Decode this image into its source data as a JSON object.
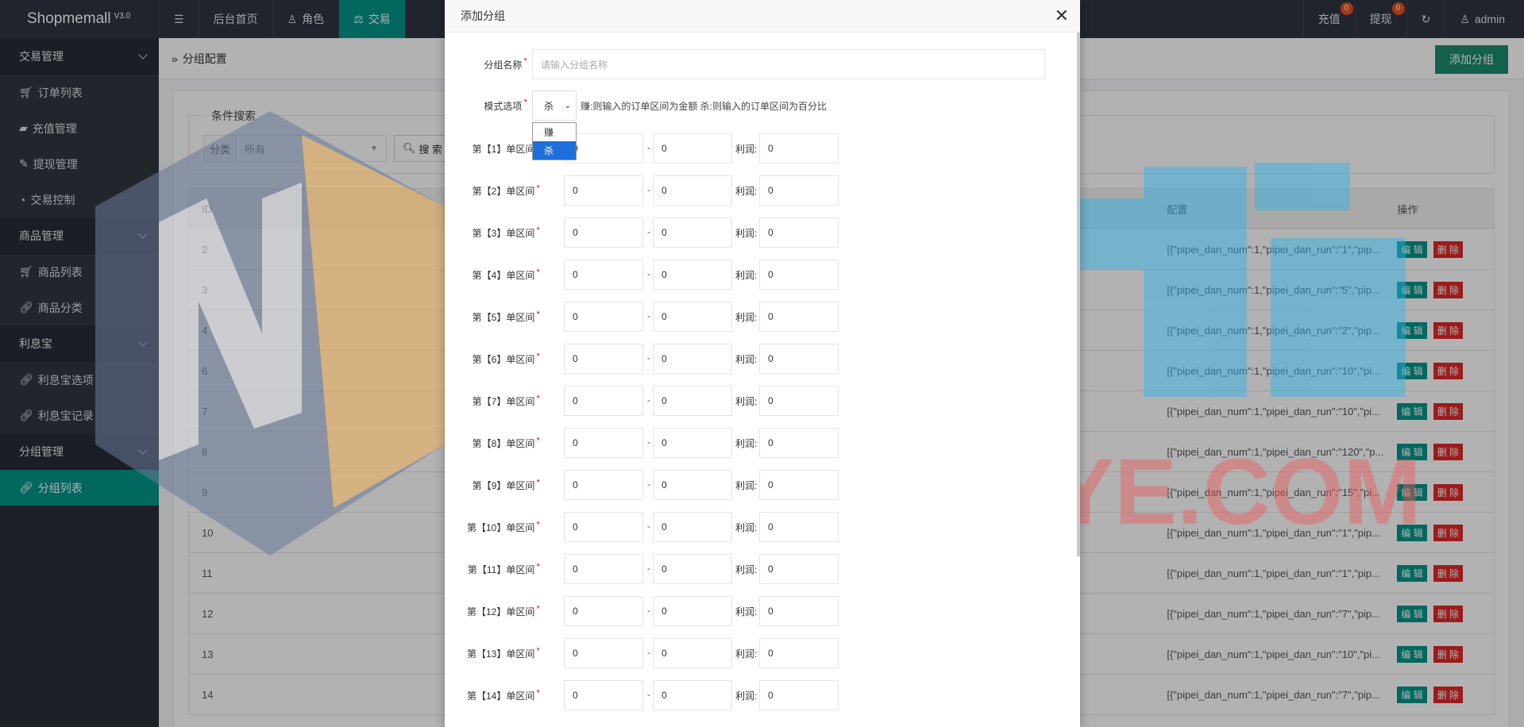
{
  "app": {
    "name": "Shopmemall",
    "version": "V3.0"
  },
  "topnav": {
    "items": [
      {
        "label": "后台首页",
        "icon": "home-icon"
      },
      {
        "label": "角色",
        "icon": "user-icon"
      },
      {
        "label": "交易",
        "icon": "scale-icon",
        "active": true
      }
    ],
    "right": [
      {
        "label": "充值",
        "badge": "0"
      },
      {
        "label": "提现",
        "badge": "0"
      },
      {
        "label": "",
        "icon": "refresh-icon"
      },
      {
        "label": "admin",
        "icon": "user-icon"
      }
    ]
  },
  "sidebar": {
    "groups": [
      {
        "label": "交易管理",
        "items": [
          "订单列表",
          "充值管理",
          "提现管理",
          "交易控制"
        ]
      },
      {
        "label": "商品管理",
        "items": [
          "商品列表",
          "商品分类"
        ]
      },
      {
        "label": "利息宝",
        "items": [
          "利息宝选项",
          "利息宝记录"
        ]
      },
      {
        "label": "分组管理",
        "items": [
          "分组列表"
        ]
      }
    ]
  },
  "main": {
    "breadcrumb": "分组配置",
    "add_button": "添加分组",
    "search": {
      "legend": "条件搜索",
      "category_label": "分类",
      "category_value": "所有",
      "button": "搜 索"
    },
    "table": {
      "headers": {
        "id": "ID",
        "config": "配置",
        "ops": "操作"
      },
      "rows": [
        {
          "id": "2",
          "config": "[{\"pipei_dan_num\":1,\"pipei_dan_run\":\"1\",\"pip..."
        },
        {
          "id": "3",
          "config": "[{\"pipei_dan_num\":1,\"pipei_dan_run\":\"5\",\"pip..."
        },
        {
          "id": "4",
          "config": "[{\"pipei_dan_num\":1,\"pipei_dan_run\":\"2\",\"pip..."
        },
        {
          "id": "6",
          "config": "[{\"pipei_dan_num\":1,\"pipei_dan_run\":\"10\",\"pi..."
        },
        {
          "id": "7",
          "config": "[{\"pipei_dan_num\":1,\"pipei_dan_run\":\"10\",\"pi..."
        },
        {
          "id": "8",
          "config": "[{\"pipei_dan_num\":1,\"pipei_dan_run\":\"120\",\"p..."
        },
        {
          "id": "9",
          "config": "[{\"pipei_dan_num\":1,\"pipei_dan_run\":\"15\",\"pi..."
        },
        {
          "id": "10",
          "config": "[{\"pipei_dan_num\":1,\"pipei_dan_run\":\"1\",\"pip..."
        },
        {
          "id": "11",
          "config": "[{\"pipei_dan_num\":1,\"pipei_dan_run\":\"1\",\"pip..."
        },
        {
          "id": "12",
          "config": "[{\"pipei_dan_num\":1,\"pipei_dan_run\":\"7\",\"pip..."
        },
        {
          "id": "13",
          "config": "[{\"pipei_dan_num\":1,\"pipei_dan_run\":\"10\",\"pi..."
        },
        {
          "id": "14",
          "config": "[{\"pipei_dan_num\":1,\"pipei_dan_run\":\"7\",\"pip..."
        }
      ],
      "edit_label": "编 辑",
      "delete_label": "删 除"
    }
  },
  "modal": {
    "title": "添加分组",
    "name_label": "分组名称",
    "name_placeholder": "请输入分组名称",
    "mode_label": "模式选项",
    "mode_value": "杀",
    "mode_options": [
      "赚",
      "杀"
    ],
    "mode_help": "赚:则输入的订单区间为金额 杀:则输入的订单区间为百分比",
    "profit_label": "利润:",
    "ranges": [
      {
        "label": "第【1】单区间",
        "from": "0",
        "to": "0",
        "profit": "0"
      },
      {
        "label": "第【2】单区间",
        "from": "0",
        "to": "0",
        "profit": "0"
      },
      {
        "label": "第【3】单区间",
        "from": "0",
        "to": "0",
        "profit": "0"
      },
      {
        "label": "第【4】单区间",
        "from": "0",
        "to": "0",
        "profit": "0"
      },
      {
        "label": "第【5】单区间",
        "from": "0",
        "to": "0",
        "profit": "0"
      },
      {
        "label": "第【6】单区间",
        "from": "0",
        "to": "0",
        "profit": "0"
      },
      {
        "label": "第【7】单区间",
        "from": "0",
        "to": "0",
        "profit": "0"
      },
      {
        "label": "第【8】单区间",
        "from": "0",
        "to": "0",
        "profit": "0"
      },
      {
        "label": "第【9】单区间",
        "from": "0",
        "to": "0",
        "profit": "0"
      },
      {
        "label": "第【10】单区间",
        "from": "0",
        "to": "0",
        "profit": "0"
      },
      {
        "label": "第【11】单区间",
        "from": "0",
        "to": "0",
        "profit": "0"
      },
      {
        "label": "第【12】单区间",
        "from": "0",
        "to": "0",
        "profit": "0"
      },
      {
        "label": "第【13】单区间",
        "from": "0",
        "to": "0",
        "profit": "0"
      },
      {
        "label": "第【14】单区间",
        "from": "0",
        "to": "0",
        "profit": "0"
      }
    ]
  },
  "watermark": {
    "text": "WWW.NAJIUYE.COM"
  },
  "colors": {
    "accent": "#009688",
    "danger": "#e02828",
    "topbar": "#2f3441",
    "sidebar": "#2a2e38"
  }
}
